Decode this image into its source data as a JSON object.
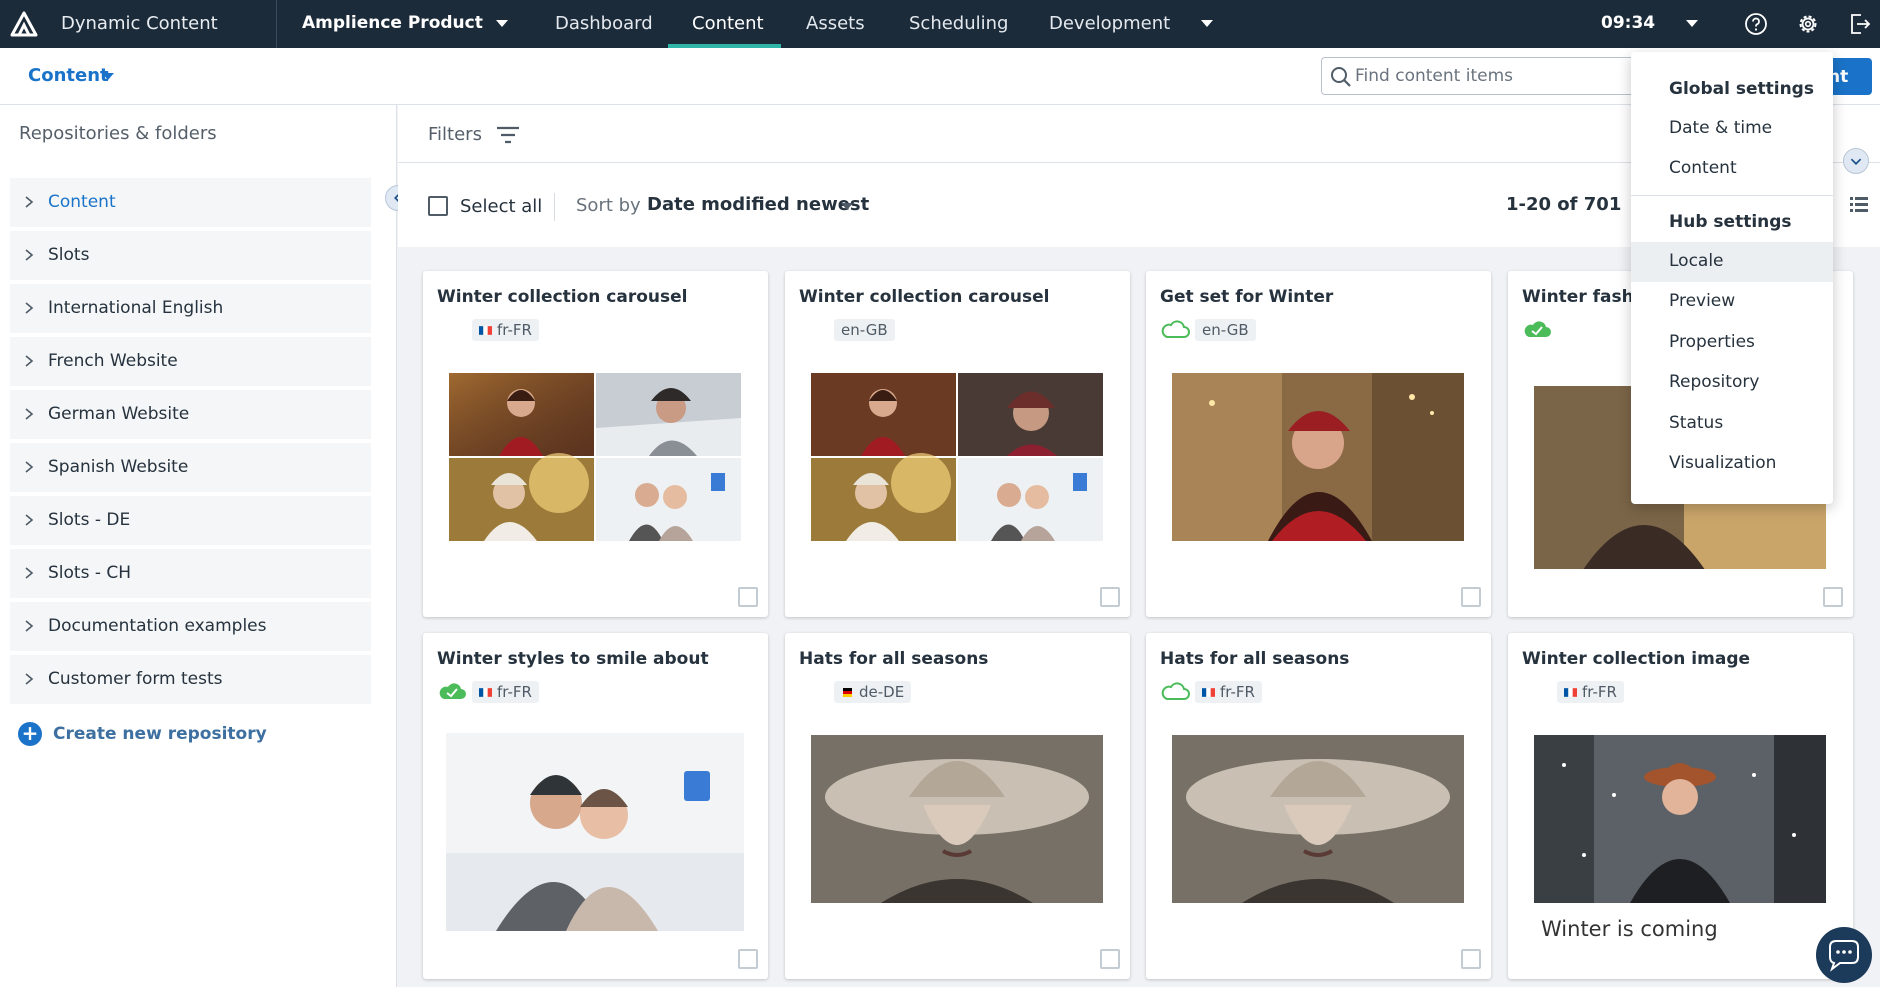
{
  "topbar": {
    "app_title": "Dynamic Content",
    "hub": "Amplience Product",
    "tabs": [
      {
        "label": "Dashboard",
        "active": false
      },
      {
        "label": "Content",
        "active": true
      },
      {
        "label": "Assets",
        "active": false
      },
      {
        "label": "Scheduling",
        "active": false
      },
      {
        "label": "Development",
        "active": false
      }
    ],
    "time": "09:34",
    "icons": [
      "amplience-logo-icon",
      "help-icon",
      "gear-icon",
      "logout-icon"
    ]
  },
  "subheader": {
    "context": "Content",
    "search_placeholder": "Find content items",
    "create_button": "nt"
  },
  "sidebar": {
    "title": "Repositories & folders",
    "items": [
      {
        "label": "Content",
        "active": true
      },
      {
        "label": "Slots"
      },
      {
        "label": "International English"
      },
      {
        "label": "French Website"
      },
      {
        "label": "German Website"
      },
      {
        "label": "Spanish Website"
      },
      {
        "label": "Slots - DE"
      },
      {
        "label": "Slots - CH"
      },
      {
        "label": "Documentation examples"
      },
      {
        "label": "Customer form tests"
      }
    ],
    "create": "Create new repository"
  },
  "filters": {
    "label": "Filters"
  },
  "toolbar": {
    "select_all": "Select all",
    "sort_label": "Sort by",
    "sort_value": "Date modified newest",
    "page_count": "1-20 of 701"
  },
  "cards": [
    {
      "title": "Winter collection carousel",
      "status": "none",
      "locale": "fr-FR",
      "flag": "fr",
      "image": "collage"
    },
    {
      "title": "Winter collection carousel",
      "status": "none",
      "locale": "en-GB",
      "flag": "",
      "image": "collage"
    },
    {
      "title": "Get set for Winter",
      "status": "cloud",
      "locale": "en-GB",
      "flag": "",
      "image": "portrait"
    },
    {
      "title": "Winter fashion",
      "status": "published",
      "locale": "",
      "flag": "",
      "image": "portrait"
    },
    {
      "title": "Winter styles to smile about",
      "status": "published",
      "locale": "fr-FR",
      "flag": "fr",
      "image": "selfie"
    },
    {
      "title": "Hats for all seasons",
      "status": "none",
      "locale": "de-DE",
      "flag": "de",
      "image": "hat"
    },
    {
      "title": "Hats for all seasons",
      "status": "cloud",
      "locale": "fr-FR",
      "flag": "fr",
      "image": "hat"
    },
    {
      "title": "Winter collection image",
      "status": "none",
      "locale": "fr-FR",
      "flag": "fr",
      "image": "snow",
      "caption": "Winter is coming"
    }
  ],
  "settings_menu": {
    "global_heading": "Global settings",
    "global_items": [
      "Date & time",
      "Content"
    ],
    "hub_heading": "Hub settings",
    "hub_items": [
      "Locale",
      "Preview",
      "Properties",
      "Repository",
      "Status",
      "Visualization"
    ],
    "hovered": "Locale"
  },
  "colors": {
    "topbar": "#1c2b39",
    "accent": "#1a73c8",
    "tab_underline": "#2fb5a8",
    "published": "#4cbb5a"
  }
}
